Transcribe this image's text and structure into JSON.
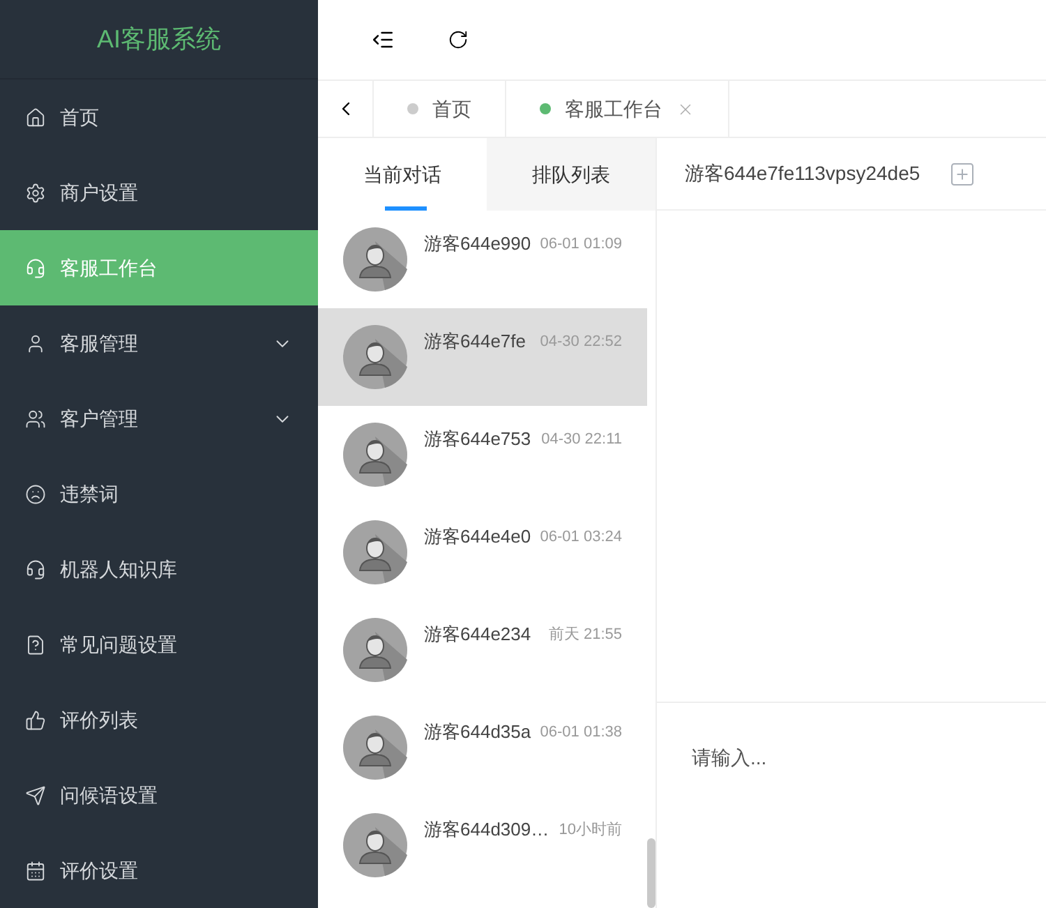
{
  "sidebar": {
    "logo": "AI客服系统",
    "items": [
      {
        "label": "首页",
        "selected": false
      },
      {
        "label": "商户设置",
        "selected": false
      },
      {
        "label": "客服工作台",
        "selected": true
      },
      {
        "label": "客服管理",
        "selected": false,
        "expanded": false
      },
      {
        "label": "客户管理",
        "selected": false,
        "expanded": false
      },
      {
        "label": "违禁词",
        "selected": false
      },
      {
        "label": "机器人知识库",
        "selected": false
      },
      {
        "label": "常见问题设置",
        "selected": false
      },
      {
        "label": "评价列表",
        "selected": false
      },
      {
        "label": "问候语设置",
        "selected": false
      },
      {
        "label": "评价设置",
        "selected": false
      }
    ]
  },
  "tabs": [
    {
      "label": "首页",
      "selected": false
    },
    {
      "label": "客服工作台",
      "selected": true
    }
  ],
  "conversation_tabs": [
    {
      "label": "当前对话",
      "selected": true
    },
    {
      "label": "排队列表",
      "selected": false
    }
  ],
  "conversations": [
    {
      "name": "游客644e990",
      "time": "06-01 01:09",
      "selected": false
    },
    {
      "name": "游客644e7fe",
      "time": "04-30 22:52",
      "selected": true
    },
    {
      "name": "游客644e753",
      "time": "04-30 22:11",
      "selected": false
    },
    {
      "name": "游客644e4e0",
      "time": "06-01 03:24",
      "selected": false
    },
    {
      "name": "游客644e234",
      "time": "前天 21:55",
      "selected": false
    },
    {
      "name": "游客644d35a",
      "time": "06-01 01:38",
      "selected": false
    },
    {
      "name": "游客644d309…",
      "time": "10小时前",
      "selected": false
    }
  ],
  "chat": {
    "title": "游客644e7fe113vpsy24de5",
    "input": {
      "placeholder": "请输入..."
    }
  }
}
